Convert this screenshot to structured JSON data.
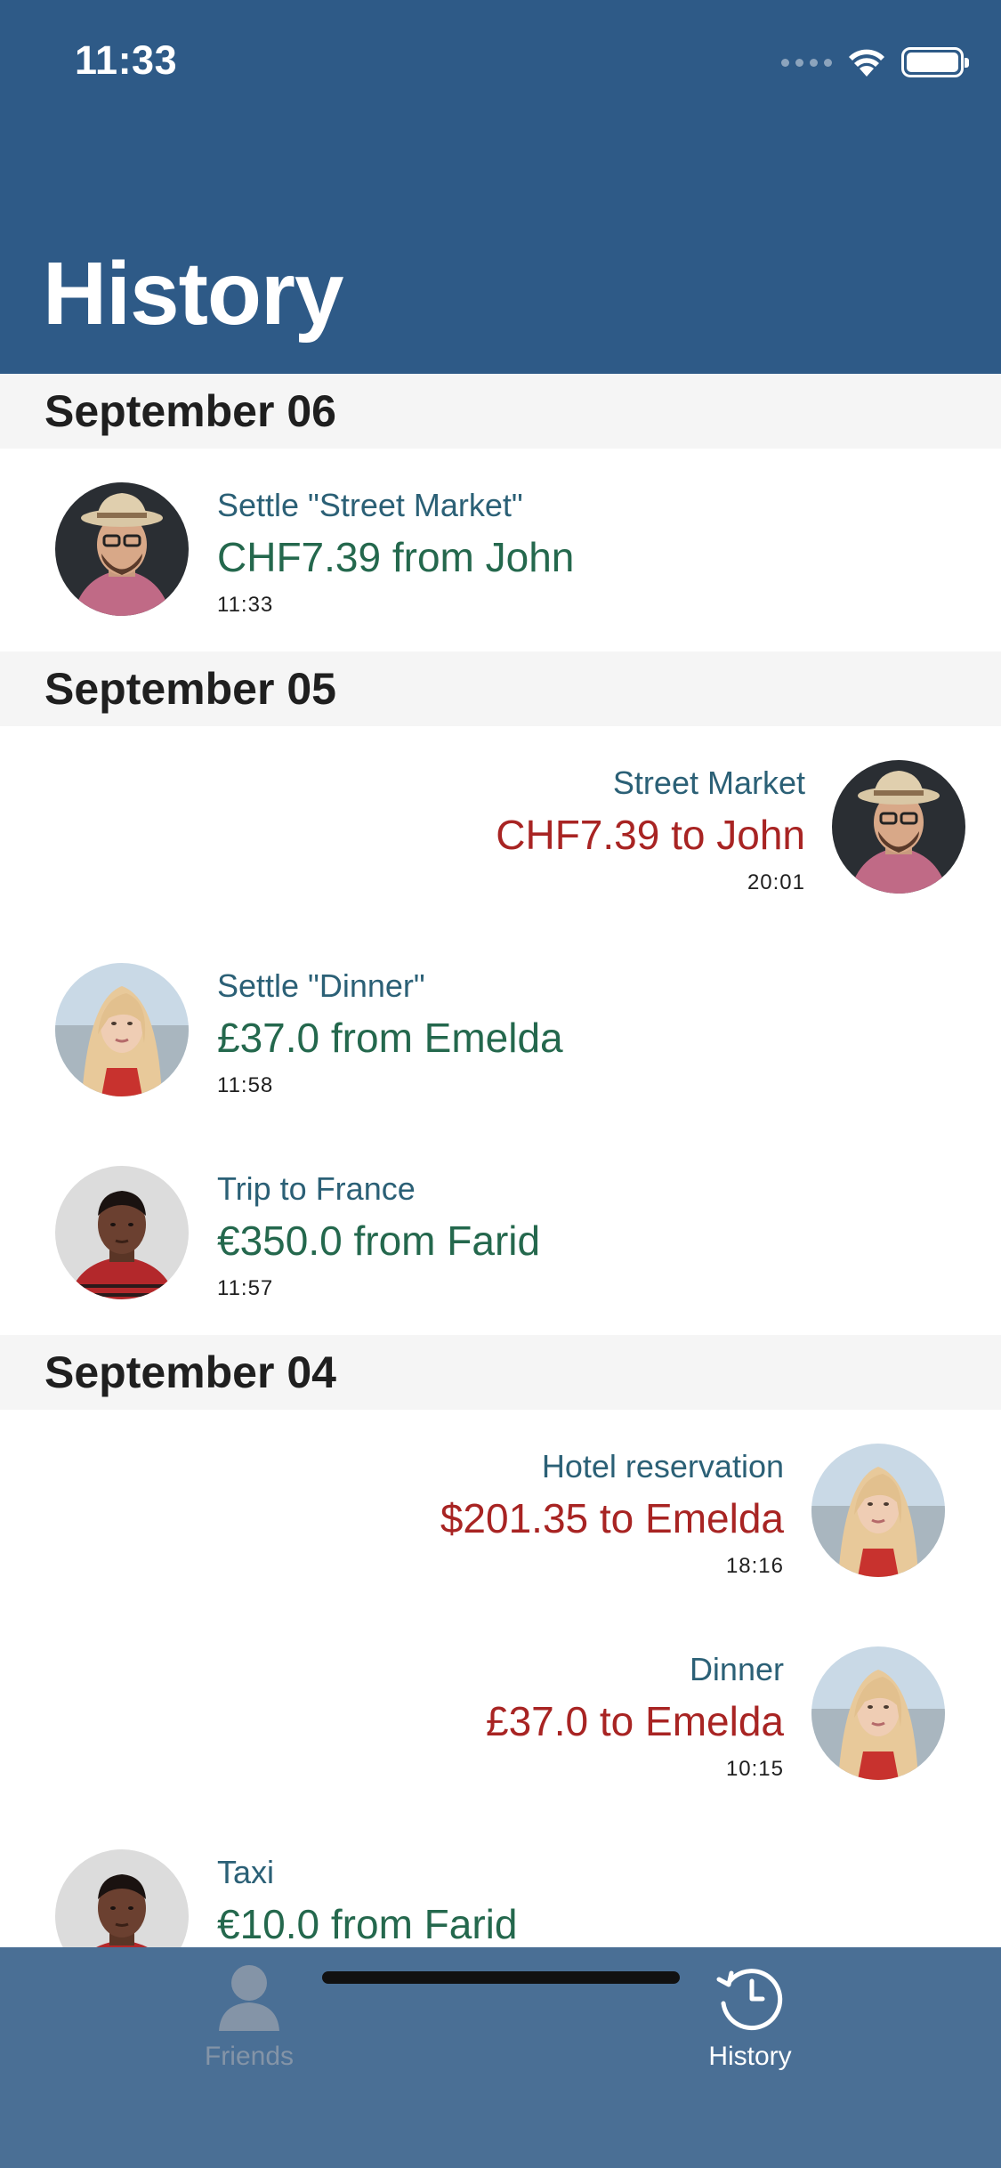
{
  "status_bar": {
    "time": "11:33"
  },
  "header": {
    "title": "History"
  },
  "sections": [
    {
      "date": "September 06",
      "items": [
        {
          "title": "Settle \"Street Market\"",
          "amount": "CHF7.39 from John",
          "time": "11:33"
        }
      ]
    },
    {
      "date": "September 05",
      "items": [
        {
          "title": "Street Market",
          "amount": "CHF7.39 to John",
          "time": "20:01"
        },
        {
          "title": "Settle \"Dinner\"",
          "amount": "£37.0 from Emelda",
          "time": "11:58"
        },
        {
          "title": "Trip to France",
          "amount": "€350.0 from Farid",
          "time": "11:57"
        }
      ]
    },
    {
      "date": "September 04",
      "items": [
        {
          "title": "Hotel reservation",
          "amount": "$201.35 to Emelda",
          "time": "18:16"
        },
        {
          "title": "Dinner",
          "amount": "£37.0 to Emelda",
          "time": "10:15"
        },
        {
          "title": "Taxi",
          "amount": "€10.0 from Farid",
          "time": ""
        }
      ]
    }
  ],
  "tabbar": {
    "tabs": [
      {
        "label": "Friends",
        "icon": "person-icon",
        "selected": false
      },
      {
        "label": "History",
        "icon": "clock-history-icon",
        "selected": true
      }
    ]
  },
  "colors": {
    "header_bg": "#2e5a87",
    "tabbar_bg": "#4a6f95",
    "amount_from": "#24684d",
    "amount_to": "#a82423",
    "title_text": "#2b6076"
  }
}
